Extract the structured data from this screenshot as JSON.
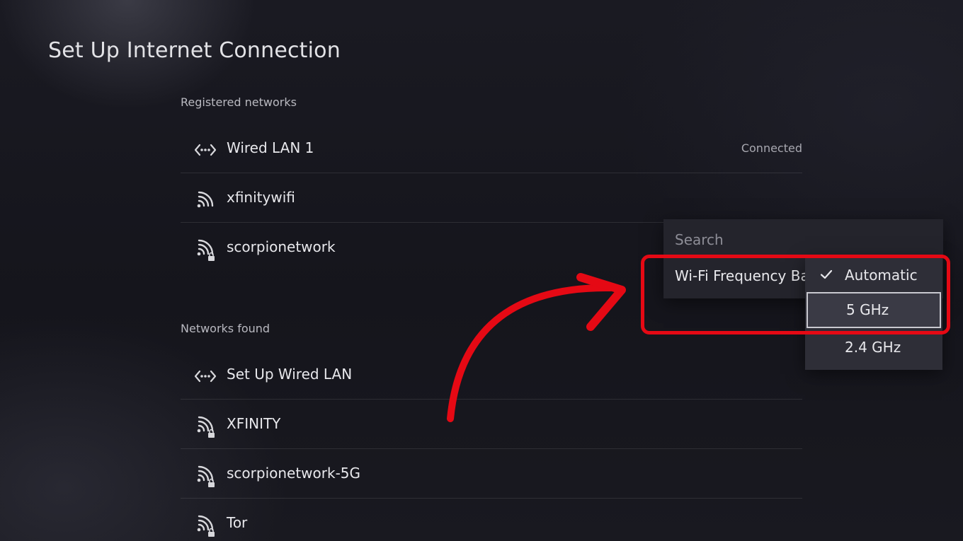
{
  "page": {
    "title": "Set Up Internet Connection"
  },
  "registered": {
    "heading": "Registered networks",
    "items": [
      {
        "label": "Wired LAN 1",
        "status": "Connected",
        "icon": "wired-lan-icon",
        "locked": false
      },
      {
        "label": "xfinitywifi",
        "status": "",
        "icon": "wifi-icon",
        "locked": false
      },
      {
        "label": "scorpionetwork",
        "status": "",
        "icon": "wifi-icon",
        "locked": true
      }
    ]
  },
  "found": {
    "heading": "Networks found",
    "items": [
      {
        "label": "Set Up Wired LAN",
        "icon": "wired-lan-icon",
        "locked": false
      },
      {
        "label": "XFINITY",
        "icon": "wifi-icon",
        "locked": true
      },
      {
        "label": "scorpionetwork-5G",
        "icon": "wifi-icon",
        "locked": true
      },
      {
        "label": "Tor",
        "icon": "wifi-icon",
        "locked": true
      }
    ]
  },
  "options_menu": {
    "search_label": "Search",
    "frequency_label": "Wi-Fi Frequency Ba",
    "frequency_options": [
      {
        "label": "Automatic",
        "selected": true,
        "focused": false
      },
      {
        "label": "5 GHz",
        "selected": false,
        "focused": true
      },
      {
        "label": "2.4 GHz",
        "selected": false,
        "focused": false
      }
    ]
  },
  "colors": {
    "annotation": "#e50914",
    "background": "#15151c",
    "menu": "#24242c",
    "submenu": "#2e2e37"
  }
}
